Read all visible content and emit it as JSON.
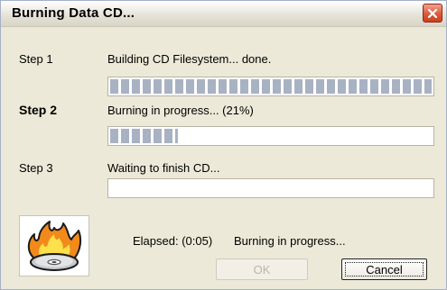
{
  "window": {
    "title": "Burning Data CD..."
  },
  "steps": [
    {
      "label": "Step 1",
      "status": "Building CD Filesystem... done.",
      "progress": 1.0
    },
    {
      "label": "Step 2",
      "status": "Burning in progress... (21%)",
      "progress": 0.21
    },
    {
      "label": "Step 3",
      "status": "Waiting to finish CD...",
      "progress": 0.0
    }
  ],
  "footer": {
    "elapsed": "Elapsed: (0:05)",
    "status": "Burning in progress...",
    "ok_label": "OK",
    "cancel_label": "Cancel"
  },
  "icons": {
    "close": "close-icon",
    "logo": "burning-disc-icon"
  },
  "colors": {
    "progress_block": "#a9b2c3",
    "close_button": "#de5a3d"
  }
}
